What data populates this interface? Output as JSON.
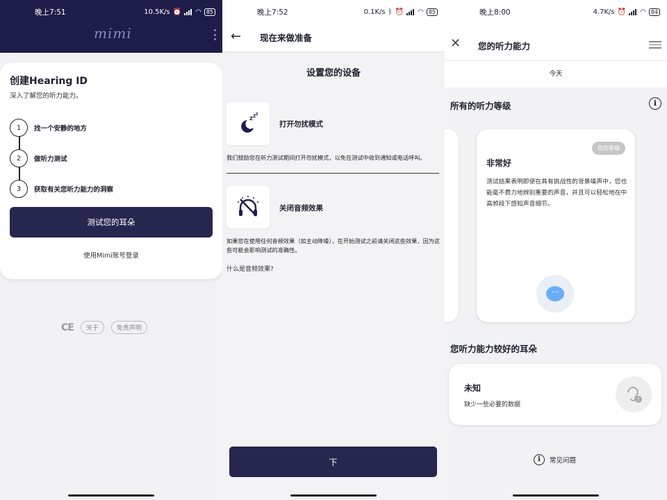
{
  "screen1": {
    "status": {
      "time": "晚上7:51",
      "speed": "10.5K/s",
      "battery": "85"
    },
    "logo": "mimi",
    "card": {
      "title": "创建Hearing ID",
      "subtitle": "深入了解您的听力能力。",
      "steps": [
        {
          "num": "1",
          "label": "找一个安静的地方"
        },
        {
          "num": "2",
          "label": "做听力测试"
        },
        {
          "num": "3",
          "label": "获取有关您听力能力的洞察"
        }
      ],
      "cta": "测试您的耳朵",
      "login": "使用Mimi账号登录"
    },
    "footer": {
      "ce": "CE",
      "about": "关于",
      "disclaimer": "免责声明"
    }
  },
  "screen2": {
    "status": {
      "time": "晚上7:52",
      "speed": "0.1K/s",
      "battery": "85"
    },
    "title": "现在来做准备",
    "heading": "设置您的设备",
    "items": [
      {
        "label": "打开勿扰模式",
        "desc": "我们鼓励您在听力测试期间打开勿扰模式，以免在测试中收到通知或电话呼叫。",
        "icon": "moon-icon"
      },
      {
        "label": "关闭音频效果",
        "desc": "如果您在使用任何音频效果（如主动降噪），在开始测试之前请关闭这些效果，因为这些可能会影响测试的准确性。",
        "icon": "audio-effect-off-icon"
      }
    ],
    "link": "什么是音频效果?",
    "cta": "下"
  },
  "screen3": {
    "status": {
      "time": "晚上8:00",
      "speed": "4.7K/s",
      "battery": "84"
    },
    "title": "您的听力能力",
    "tab": "今天",
    "section_levels": "所有的听力等级",
    "grade": {
      "badge": "您的等级",
      "title": "非常好",
      "desc": "测试结果表明即使在具有挑战性的背景噪声中，您也能毫不费力地辨别重要的声音，并且可以轻松地在中高频段下感知声音细节。",
      "bubble": "···"
    },
    "section_ear": "您听力能力较好的耳朵",
    "ear": {
      "title": "未知",
      "desc": "缺少一些必要的数据"
    },
    "faq": "常见问题"
  },
  "colors": {
    "navy": "#1e1d4a",
    "button": "#27264f",
    "accent_blue": "#69aef5"
  }
}
